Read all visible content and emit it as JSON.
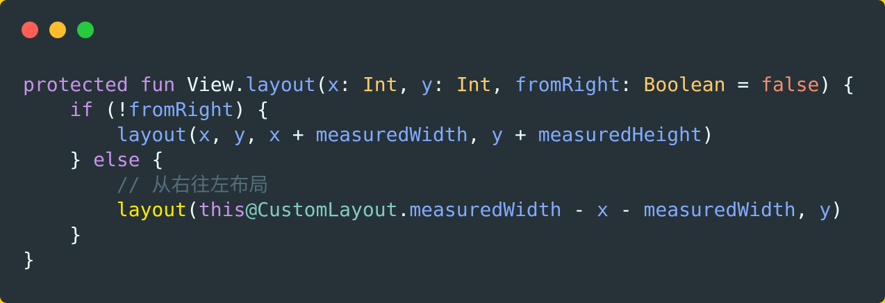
{
  "window": {
    "dots": [
      {
        "name": "close",
        "color": "#ff5f56"
      },
      {
        "name": "minimize",
        "color": "#ffbd2e"
      },
      {
        "name": "maximize",
        "color": "#27c93f"
      }
    ]
  },
  "code": {
    "lines": [
      [
        {
          "t": "protected",
          "c": "kw"
        },
        {
          "t": " ",
          "c": "pl"
        },
        {
          "t": "fun",
          "c": "kw"
        },
        {
          "t": " View.",
          "c": "pl"
        },
        {
          "t": "layout",
          "c": "fn"
        },
        {
          "t": "(",
          "c": "pl"
        },
        {
          "t": "x",
          "c": "var"
        },
        {
          "t": ": ",
          "c": "pl"
        },
        {
          "t": "Int",
          "c": "type"
        },
        {
          "t": ", ",
          "c": "pl"
        },
        {
          "t": "y",
          "c": "var"
        },
        {
          "t": ": ",
          "c": "pl"
        },
        {
          "t": "Int",
          "c": "type"
        },
        {
          "t": ", ",
          "c": "pl"
        },
        {
          "t": "fromRight",
          "c": "var"
        },
        {
          "t": ": ",
          "c": "pl"
        },
        {
          "t": "Boolean",
          "c": "type"
        },
        {
          "t": " = ",
          "c": "pl"
        },
        {
          "t": "false",
          "c": "lit"
        },
        {
          "t": ") {",
          "c": "pl"
        }
      ],
      [
        {
          "t": "    ",
          "c": "pl"
        },
        {
          "t": "if",
          "c": "kw"
        },
        {
          "t": " (!",
          "c": "pl"
        },
        {
          "t": "fromRight",
          "c": "var"
        },
        {
          "t": ") {",
          "c": "pl"
        }
      ],
      [
        {
          "t": "        ",
          "c": "pl"
        },
        {
          "t": "layout",
          "c": "fn"
        },
        {
          "t": "(",
          "c": "pl"
        },
        {
          "t": "x",
          "c": "var"
        },
        {
          "t": ", ",
          "c": "pl"
        },
        {
          "t": "y",
          "c": "var"
        },
        {
          "t": ", ",
          "c": "pl"
        },
        {
          "t": "x",
          "c": "var"
        },
        {
          "t": " + ",
          "c": "pl"
        },
        {
          "t": "measuredWidth",
          "c": "var"
        },
        {
          "t": ", ",
          "c": "pl"
        },
        {
          "t": "y",
          "c": "var"
        },
        {
          "t": " + ",
          "c": "pl"
        },
        {
          "t": "measuredHeight",
          "c": "var"
        },
        {
          "t": ")",
          "c": "pl"
        }
      ],
      [
        {
          "t": "    } ",
          "c": "pl"
        },
        {
          "t": "else",
          "c": "kw"
        },
        {
          "t": " {",
          "c": "pl"
        }
      ],
      [
        {
          "t": "        ",
          "c": "pl"
        },
        {
          "t": "// 从右往左布局",
          "c": "cm"
        }
      ],
      [
        {
          "t": "        ",
          "c": "pl"
        },
        {
          "t": "layout",
          "c": "yel"
        },
        {
          "t": "(",
          "c": "pl"
        },
        {
          "t": "this",
          "c": "kw"
        },
        {
          "t": "@CustomLayout",
          "c": "cls"
        },
        {
          "t": ".",
          "c": "pl"
        },
        {
          "t": "measuredWidth",
          "c": "var"
        },
        {
          "t": " - ",
          "c": "pl"
        },
        {
          "t": "x",
          "c": "var"
        },
        {
          "t": " - ",
          "c": "pl"
        },
        {
          "t": "measuredWidth",
          "c": "var"
        },
        {
          "t": ", ",
          "c": "pl"
        },
        {
          "t": "y",
          "c": "var"
        },
        {
          "t": ")",
          "c": "pl"
        }
      ],
      [
        {
          "t": "    }",
          "c": "pl"
        }
      ],
      [
        {
          "t": "}",
          "c": "pl"
        }
      ]
    ]
  }
}
